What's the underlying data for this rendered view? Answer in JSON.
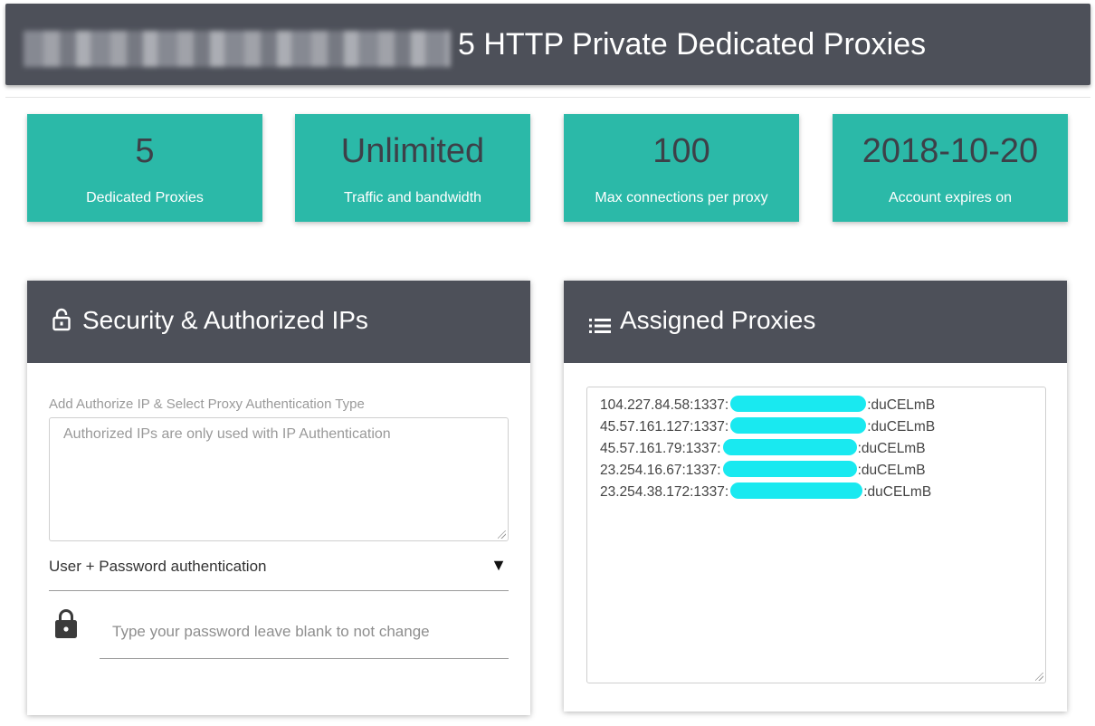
{
  "header": {
    "title": "5 HTTP Private Dedicated Proxies"
  },
  "stats": [
    {
      "value": "5",
      "label": "Dedicated Proxies"
    },
    {
      "value": "Unlimited",
      "label": "Traffic and bandwidth"
    },
    {
      "value": "100",
      "label": "Max connections per proxy"
    },
    {
      "value": "2018-10-20",
      "label": "Account expires on"
    }
  ],
  "security": {
    "title": "Security & Authorized IPs",
    "field_label": "Add Authorize IP & Select Proxy Authentication Type",
    "ips_placeholder": "Authorized IPs are only used with IP Authentication",
    "auth_type": "User + Password authentication",
    "password_placeholder": "Type your password leave blank to not change"
  },
  "proxies": {
    "title": "Assigned Proxies",
    "list": [
      {
        "address": "104.227.84.58:1337:",
        "suffix": ":duCELmB"
      },
      {
        "address": "45.57.161.127:1337:",
        "suffix": ":duCELmB"
      },
      {
        "address": "45.57.161.79:1337:",
        "suffix": ":duCELmB"
      },
      {
        "address": "23.254.16.67:1337:",
        "suffix": ":duCELmB"
      },
      {
        "address": "23.254.38.172:1337:",
        "suffix": ":duCELmB"
      }
    ]
  },
  "colors": {
    "header_bg": "#4d5059",
    "stat_bg": "#2bb9a8",
    "stat_value": "#3d4048",
    "redaction": "#19e9f0"
  },
  "icons": {
    "security_head": "lock-open-icon",
    "proxies_head": "list-icon",
    "password": "lock-icon",
    "select": "triangle-down-icon"
  }
}
